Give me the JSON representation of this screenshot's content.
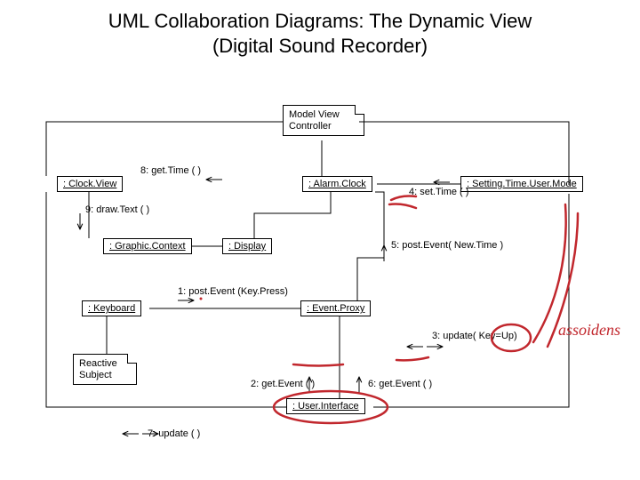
{
  "title_line1": "UML Collaboration Diagrams: The Dynamic View",
  "title_line2": "(Digital Sound Recorder)",
  "nodes": {
    "mvc": "Model View\nController",
    "clockview": ": Clock.View",
    "alarmclock": ": Alarm.Clock",
    "settingmode": ": Setting.Time.User.Mode",
    "graphiccontext": ": Graphic.Context",
    "display": ": Display",
    "keyboard": ": Keyboard",
    "reactive": "Reactive\nSubject",
    "eventproxy": ": Event.Proxy",
    "userinterface": ": User.Interface"
  },
  "messages": {
    "m1": "1: post.Event (Key.Press)",
    "m2": "2: get.Event ( )",
    "m3": "3: update( Key=Up)",
    "m4": "4: set.Time ( )",
    "m5": "5: post.Event( New.Time )",
    "m6": "6: get.Event ( )",
    "m7": "7: update ( )",
    "m8": "8: get.Time ( )",
    "m9": "9: draw.Text ( )"
  },
  "handwriting": "assoidens"
}
